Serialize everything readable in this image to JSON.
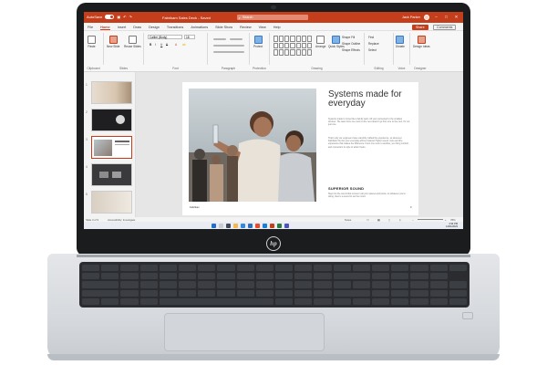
{
  "window": {
    "autosave_label": "AutoSave",
    "doc_title": "Fabrikam Sales Deck - Saved",
    "search_placeholder": "Search",
    "user_name": "Jack Parker"
  },
  "menubar": {
    "tabs": [
      "File",
      "Home",
      "Insert",
      "Draw",
      "Design",
      "Transitions",
      "Animations",
      "Slide Show",
      "Review",
      "View",
      "Help"
    ],
    "active_tab": "Home",
    "share_label": "Share",
    "comments_label": "Comments"
  },
  "ribbon": {
    "font_name": "Calibri (Body)",
    "font_size": "18",
    "groups": [
      "Clipboard",
      "Slides",
      "Font",
      "Paragraph",
      "Protection",
      "Drawing",
      "Editing",
      "Voice",
      "Designer"
    ],
    "buttons": {
      "paste": "Paste",
      "new_slide": "New Slide",
      "reuse_slides": "Reuse Slides",
      "protect": "Protect",
      "arrange": "Arrange",
      "quick_styles": "Quick Styles",
      "shape_fill": "Shape Fill",
      "shape_outline": "Shape Outline",
      "shape_effects": "Shape Effects",
      "find": "Find",
      "replace": "Replace",
      "select": "Select",
      "dictate": "Dictate",
      "design_ideas": "Design Ideas"
    }
  },
  "slide": {
    "title": "Systems made for everyday",
    "paragraph_1": "Systems made to move like a family team. All your connected to the smallest devices. The team from one room to the next doesn't go from one to the next, it's not just one.",
    "paragraph_2": "That's why our engineers have carefully crafted the experience, so wherever Fabrikam fits into your everyday will feel natural. Higher sound, more and the experience that makes the difference. From one room to another, you bring comfort, and connection to style to what it feels.",
    "subheading": "SUPERIOR SOUND",
    "paragraph_3": "Step into the sound that comes in all your spaces and pixels, so whatever you're doing, there's a sound to set the mood.",
    "footer_left": "Fabrikam",
    "page_num": "3"
  },
  "status": {
    "slide_info": "Slide 3 of 9",
    "accessibility": "Accessibility: Investigate",
    "notes": "Notes",
    "zoom": "78%"
  },
  "taskbar": {
    "time": "4:34 PM",
    "date": "12/01/2023"
  },
  "device": {
    "logo": "hp"
  }
}
